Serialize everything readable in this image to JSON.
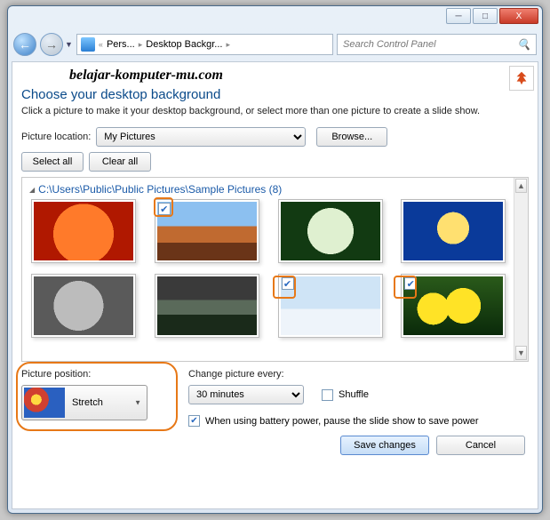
{
  "window": {
    "minimize": "─",
    "maximize": "□",
    "close": "X"
  },
  "nav": {
    "back": "←",
    "forward": "→",
    "crumb1": "Pers...",
    "crumb2": "Desktop Backgr...",
    "sep": "«",
    "search_placeholder": "Search Control Panel"
  },
  "watermark": "belajar-komputer-mu.com",
  "heading": "Choose your desktop background",
  "subheading": "Click a picture to make it your desktop background, or select more than one picture to create a slide show.",
  "picture_location_label": "Picture location:",
  "picture_location_value": "My Pictures",
  "browse_btn": "Browse...",
  "select_all_btn": "Select all",
  "clear_all_btn": "Clear all",
  "group_title": "C:\\Users\\Public\\Public Pictures\\Sample Pictures (8)",
  "picture_position_label": "Picture position:",
  "picture_position_value": "Stretch",
  "change_every_label": "Change picture every:",
  "change_every_value": "30 minutes",
  "shuffle_label": "Shuffle",
  "battery_label": "When using battery power, pause the slide show to save power",
  "save_btn": "Save changes",
  "cancel_btn": "Cancel",
  "thumbs": [
    {
      "name": "orange-flower",
      "checked": false,
      "bg": "radial-gradient(circle at 50% 55%, #ff7a2a 0 34px, #b01800 34px)"
    },
    {
      "name": "desert",
      "checked": true,
      "bg": "linear-gradient(#8cc0f0 0 42%, #c06a30 42% 70%, #6a3418 70%)"
    },
    {
      "name": "hydrangea",
      "checked": false,
      "bg": "radial-gradient(circle at 50% 50%, #dff0d0 0 26px, #123a12 26px)"
    },
    {
      "name": "jellyfish",
      "checked": false,
      "bg": "radial-gradient(circle at 50% 45%, #ffe070 0 18px, #0a3a9a 18px)"
    },
    {
      "name": "koala",
      "checked": false,
      "bg": "radial-gradient(circle at 45% 50%, #bcbcbc 0 28px, #5a5a5a 28px)"
    },
    {
      "name": "lighthouse",
      "checked": false,
      "bg": "linear-gradient(#3a3a3a 0 40%, #5a6a5a 40% 65%, #1a2a1a 65%)"
    },
    {
      "name": "penguins",
      "checked": true,
      "bg": "linear-gradient(#cfe4f6 0 55%, #eef4fa 55%), radial-gradient(circle at 40% 55%, #111 0 14px, transparent 14px), radial-gradient(circle at 62% 55%, #111 0 14px, transparent 14px)"
    },
    {
      "name": "tulips",
      "checked": true,
      "bg": "radial-gradient(circle at 30% 55%, #ffe326 0 18px, transparent 18px), radial-gradient(circle at 60% 50%, #ffe326 0 20px, transparent 20px), linear-gradient(#2a5a1a,#0a2a0a)"
    }
  ]
}
